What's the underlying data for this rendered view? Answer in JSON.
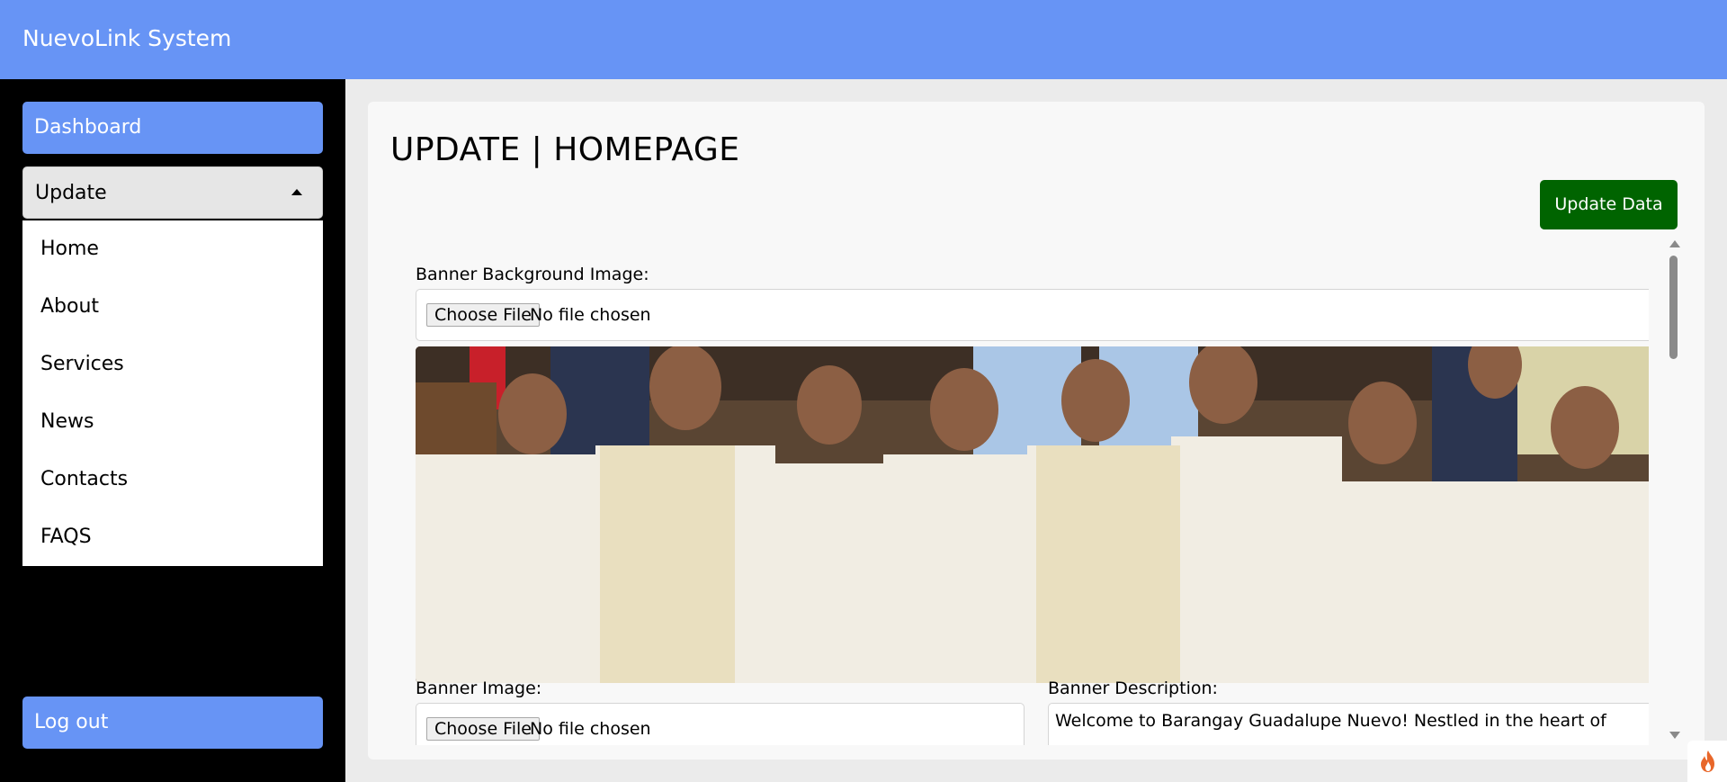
{
  "app": {
    "title": "NuevoLink System"
  },
  "sidebar": {
    "dashboard_label": "Dashboard",
    "update_label": "Update",
    "submenu": [
      "Home",
      "About",
      "Services",
      "News",
      "Contacts",
      "FAQS"
    ],
    "logout_label": "Log out"
  },
  "main": {
    "page_title": "UPDATE | HOMEPAGE",
    "update_button": "Update Data",
    "banner_background": {
      "label": "Banner Background Image:",
      "choose_file": "Choose File",
      "status": "No file chosen"
    },
    "banner_image": {
      "label": "Banner Image:",
      "choose_file": "Choose File",
      "status": "No file chosen"
    },
    "banner_description": {
      "label": "Banner Description:",
      "value": "Welcome to Barangay Guadalupe Nuevo! Nestled in the heart of"
    }
  },
  "icons": {
    "submenu_toggle": "caret-up-icon",
    "corner_badge": "flame-icon"
  },
  "colors": {
    "primary": "#6794f5",
    "update_button": "#006400",
    "sidebar": "#000000"
  }
}
